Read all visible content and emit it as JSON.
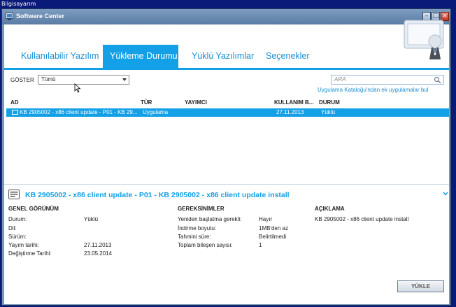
{
  "desktop": {
    "label": "Bilgisayarım"
  },
  "window": {
    "title": "Software Center"
  },
  "tabs": [
    {
      "label": "Kullanılabilir Yazılım"
    },
    {
      "label": "Yükleme Durumu"
    },
    {
      "label": "Yüklü Yazılımlar"
    },
    {
      "label": "Seçenekler"
    }
  ],
  "filter": {
    "label": "GÖSTER",
    "value": "Tümü"
  },
  "search": {
    "placeholder": "ARA"
  },
  "catalog_link": "Uygulama Kataloğu'ndan ek uygulamalar bul",
  "table": {
    "headers": {
      "name": "AD",
      "type": "TÜR",
      "publisher": "YAYIMCI",
      "date": "KULLANIM B...",
      "status": "DURUM"
    },
    "rows": [
      {
        "name": "KB 2905002 - x86 client update - P01 - KB 29...",
        "type": "Uygulama",
        "publisher": "",
        "date": "27.11.2013",
        "status": "Yüklü"
      }
    ]
  },
  "detail": {
    "title": "KB 2905002 - x86 client update - P01 - KB 2905002 - x86 client update install",
    "general": {
      "heading": "GENEL GÖRÜNÜM",
      "fields": [
        {
          "label": "Durum:",
          "value": "Yüklü"
        },
        {
          "label": "Dil:",
          "value": ""
        },
        {
          "label": "Sürüm:",
          "value": ""
        },
        {
          "label": "Yayım tarihi:",
          "value": "27.11.2013"
        },
        {
          "label": "Değiştirme Tarihi:",
          "value": "23.05.2014"
        }
      ]
    },
    "requirements": {
      "heading": "GEREKSİNİMLER",
      "fields": [
        {
          "label": "Yeniden başlatma gerekli:",
          "value": "Hayır"
        },
        {
          "label": "İndirme boyutu:",
          "value": "1MB'den az"
        },
        {
          "label": "Tahmini süre:",
          "value": "Belirtilmedi"
        },
        {
          "label": "Toplam bileşen sayısı:",
          "value": "1"
        }
      ]
    },
    "description": {
      "heading": "AÇIKLAMA",
      "text": "KB 2905002 - x86 client update install"
    },
    "install_label": "YÜKLE"
  },
  "colors": {
    "accent": "#14a0e6",
    "desktop": "#0a1a78"
  },
  "icons": [
    "app-icon",
    "minimize-icon",
    "maximize-icon",
    "close-icon",
    "computer-icon",
    "search-icon",
    "mouse-cursor-icon",
    "package-icon",
    "chevron-down-icon"
  ]
}
